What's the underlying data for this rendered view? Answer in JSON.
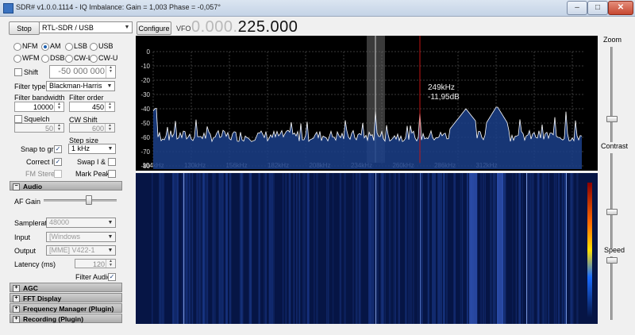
{
  "window": {
    "title": "SDR# v1.0.0.1114 - IQ Imbalance: Gain = 1,003 Phase = -0,057°",
    "minimize": "–",
    "maximize": "□",
    "close": "✕"
  },
  "toolbar": {
    "stop_label": "Stop",
    "source_value": "RTL-SDR / USB",
    "configure_label": "Configure",
    "vfo_label": "VFO",
    "vfo_dim": "0.000.",
    "vfo_bright": "225.000"
  },
  "modes": [
    "NFM",
    "AM",
    "LSB",
    "USB",
    "WFM",
    "DSB",
    "CW-L",
    "CW-U"
  ],
  "selected_mode": "AM",
  "shift": {
    "label": "Shift",
    "value": "-50 000 000"
  },
  "filter": {
    "type_label": "Filter type",
    "type_value": "Blackman-Harris",
    "bandwidth_label": "Filter bandwidth",
    "bandwidth_value": "10000",
    "order_label": "Filter order",
    "order_value": "450"
  },
  "squelch": {
    "label": "Squelch",
    "value": "50"
  },
  "cw_shift": {
    "label": "CW Shift",
    "value": "600"
  },
  "step": {
    "label": "Step size",
    "value": "1 kHz"
  },
  "checks": {
    "snap": "Snap to grid",
    "correct_iq": "Correct IQ",
    "swap_iq": "Swap I & Q",
    "fm_stereo": "FM Stereo",
    "mark_peaks": "Mark Peaks"
  },
  "audio": {
    "section_label": "Audio",
    "af_gain_label": "AF Gain",
    "af_gain_level": 0.62,
    "samplerate_label": "Samplerate",
    "samplerate_value": "48000",
    "input_label": "Input",
    "input_value": "[Windows DirectSound]",
    "output_label": "Output",
    "output_value": "[MME] V422-1 (NVIDIA",
    "latency_label": "Latency (ms)",
    "latency_value": "120",
    "filter_audio_label": "Filter Audio"
  },
  "sections": [
    "AGC",
    "FFT Display",
    "Frequency Manager (Plugin)",
    "Recording (Plugin)"
  ],
  "spectrum": {
    "y_ticks": [
      "0",
      "-10",
      "-20",
      "-30",
      "-40",
      "-50",
      "-60",
      "-70",
      "-80"
    ],
    "x_ticks": [
      "104kHz",
      "130kHz",
      "156kHz",
      "182kHz",
      "208kHz",
      "234kHz",
      "260kHz",
      "286kHz",
      "312kHz"
    ],
    "cursor_freq": "249kHz",
    "cursor_level": "-11,95dB"
  },
  "right": {
    "zoom_label": "Zoom",
    "contrast_label": "Contrast",
    "speed_label": "Speed"
  },
  "colors": {
    "spectrum_bg": "#000000",
    "trace": "#ffffff",
    "fill": "#1b3f8a",
    "grid": "#3a3a3a",
    "cursor": "#c21515",
    "waterfall_bg": "#061545"
  }
}
